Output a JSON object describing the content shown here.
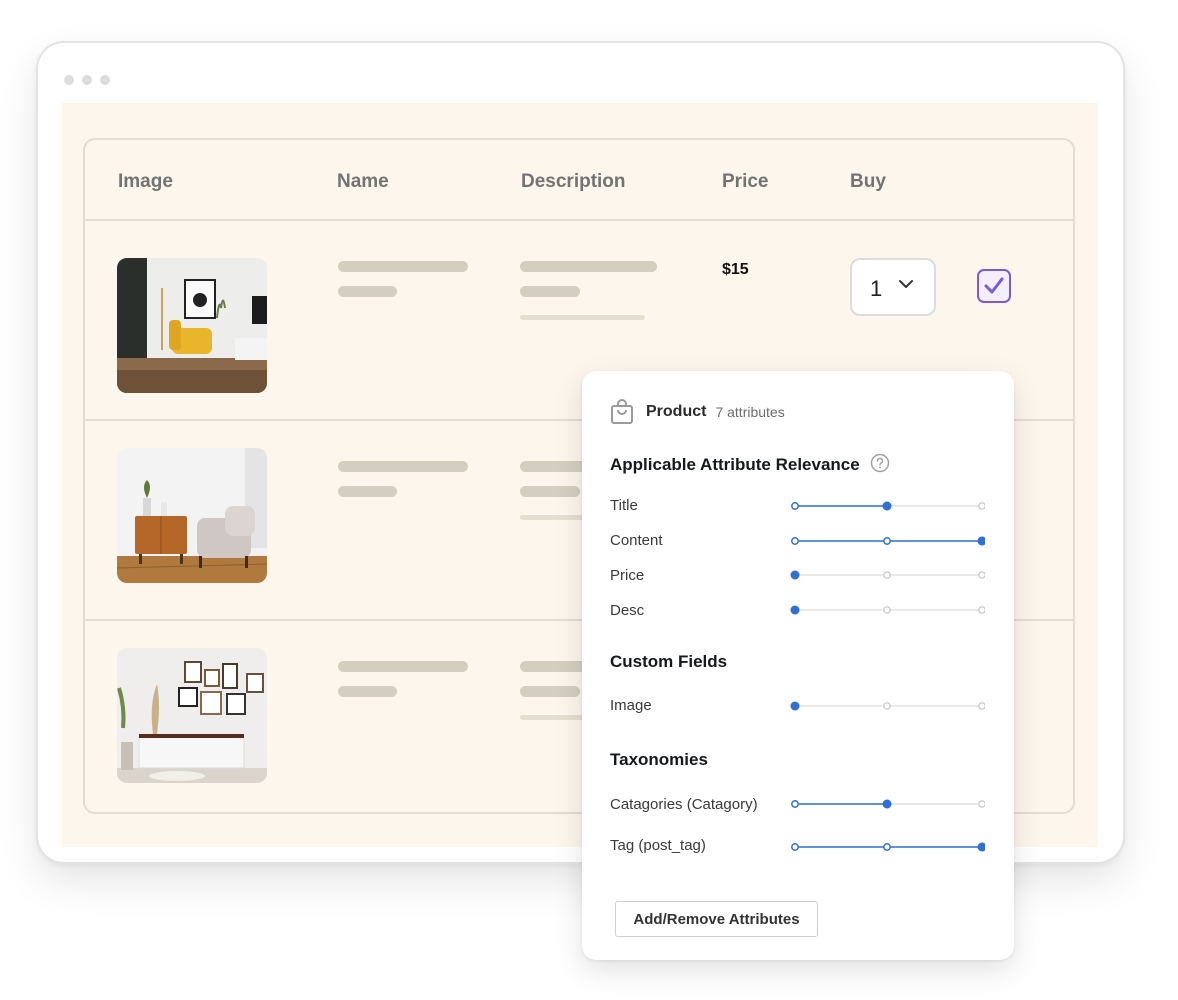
{
  "table": {
    "columns": [
      "Image",
      "Name",
      "Description",
      "Price",
      "Buy"
    ],
    "rows": [
      {
        "image": "living-room-yellow-chair",
        "price": "$15",
        "quantity": "1",
        "checked": true
      },
      {
        "image": "living-room-wood-sideboard"
      },
      {
        "image": "gallery-wall-cabinet"
      }
    ]
  },
  "popover": {
    "title": "Product",
    "subtitle": "7 attributes",
    "relevance_heading": "Applicable Attribute Relevance",
    "custom_heading": "Custom Fields",
    "taxonomies_heading": "Taxonomies",
    "relevance_items": [
      {
        "label": "Title",
        "level": 2
      },
      {
        "label": "Content",
        "level": 3
      },
      {
        "label": "Price",
        "level": 1
      },
      {
        "label": "Desc",
        "level": 1
      }
    ],
    "custom_items": [
      {
        "label": "Image",
        "level": 1
      }
    ],
    "taxonomy_items": [
      {
        "label": "Catagories (Catagory)",
        "level": 2
      },
      {
        "label": "Tag (post_tag)",
        "level": 3
      }
    ],
    "button_label": "Add/Remove Attributes"
  },
  "colors": {
    "accent_blue": "#2f6fd6",
    "check_purple": "#7b5bd3",
    "canvas_bg": "#fdf6ec"
  }
}
